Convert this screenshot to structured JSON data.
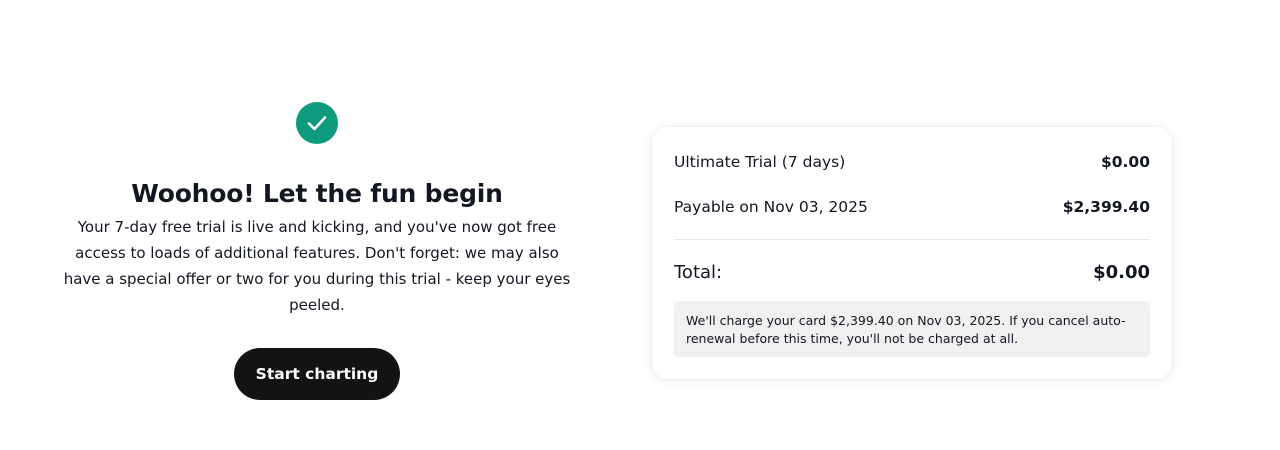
{
  "success": {
    "icon": "checkmark-icon",
    "icon_color": "#0e9a7c",
    "title": "Woohoo! Let the fun begin",
    "message": "Your 7-day free trial is live and kicking, and you've now got free access to loads of additional features. Don't forget: we may also have a special offer or two for you during this trial - keep your eyes peeled.",
    "cta_label": "Start charting"
  },
  "summary": {
    "plan_label": "Ultimate Trial (7 days)",
    "plan_amount": "$0.00",
    "payable_label": "Payable on Nov 03, 2025",
    "payable_amount": "$2,399.40",
    "total_label": "Total:",
    "total_amount": "$0.00",
    "notice": "We'll charge your card $2,399.40 on Nov 03, 2025. If you cancel auto-renewal before this time, you'll not be charged at all."
  }
}
